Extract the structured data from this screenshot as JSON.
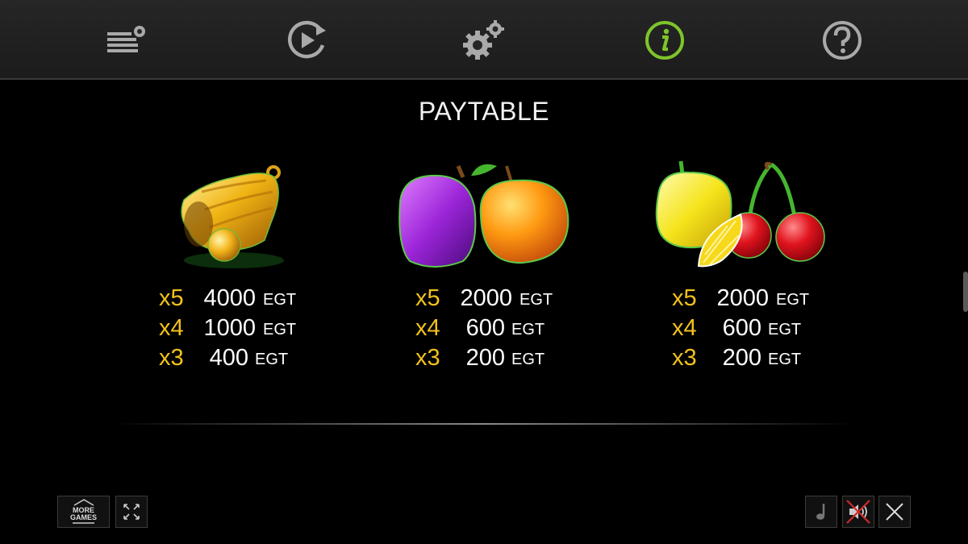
{
  "topbar": {
    "buttons": [
      {
        "name": "paytable-settings-icon"
      },
      {
        "name": "autoplay-icon"
      },
      {
        "name": "settings-gear-icon"
      },
      {
        "name": "info-icon",
        "active": true,
        "color": "#7ec42b"
      },
      {
        "name": "help-icon"
      }
    ]
  },
  "paytable": {
    "title": "PAYTABLE",
    "symbols": [
      {
        "name": "bell",
        "rows": [
          {
            "mult": "x5",
            "amount": "4000",
            "currency": "EGT"
          },
          {
            "mult": "x4",
            "amount": "1000",
            "currency": "EGT"
          },
          {
            "mult": "x3",
            "amount": "400",
            "currency": "EGT"
          }
        ]
      },
      {
        "name": "plum-orange",
        "rows": [
          {
            "mult": "x5",
            "amount": "2000",
            "currency": "EGT"
          },
          {
            "mult": "x4",
            "amount": "600",
            "currency": "EGT"
          },
          {
            "mult": "x3",
            "amount": "200",
            "currency": "EGT"
          }
        ]
      },
      {
        "name": "lemon-cherry",
        "rows": [
          {
            "mult": "x5",
            "amount": "2000",
            "currency": "EGT"
          },
          {
            "mult": "x4",
            "amount": "600",
            "currency": "EGT"
          },
          {
            "mult": "x3",
            "amount": "200",
            "currency": "EGT"
          }
        ]
      }
    ]
  },
  "bottom": {
    "more_games_line1": "MORE",
    "more_games_line2": "GAMES"
  },
  "colors": {
    "multiplier": "#f2c21b",
    "accent": "#7ec42b",
    "mute_cross": "#d02a2a"
  }
}
